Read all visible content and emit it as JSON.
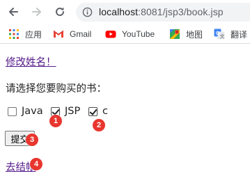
{
  "browser": {
    "url_host": "localhost",
    "url_rest": ":8081/jsp3/book.jsp",
    "bookmarks": [
      {
        "icon": "apps-grid-icon",
        "label": "应用"
      },
      {
        "icon": "gmail-icon",
        "label": "Gmail"
      },
      {
        "icon": "youtube-icon",
        "label": "YouTube"
      },
      {
        "icon": "maps-icon",
        "label": "地图"
      },
      {
        "icon": "translate-icon",
        "label": "翻译"
      }
    ]
  },
  "page": {
    "rename_link": "修改姓名！",
    "prompt": "请选择您要购买的书：",
    "options": [
      {
        "label": "Java",
        "checked": false
      },
      {
        "label": "JSP",
        "checked": true
      },
      {
        "label": "c",
        "checked": true
      }
    ],
    "submit_label": "提交",
    "checkout_link": "去结帐"
  },
  "annotations": [
    "1",
    "2",
    "3",
    "4"
  ],
  "colors": {
    "link": "#551a8b",
    "badge": "#e8362f",
    "omnibox_bg": "#f1f3f4"
  }
}
